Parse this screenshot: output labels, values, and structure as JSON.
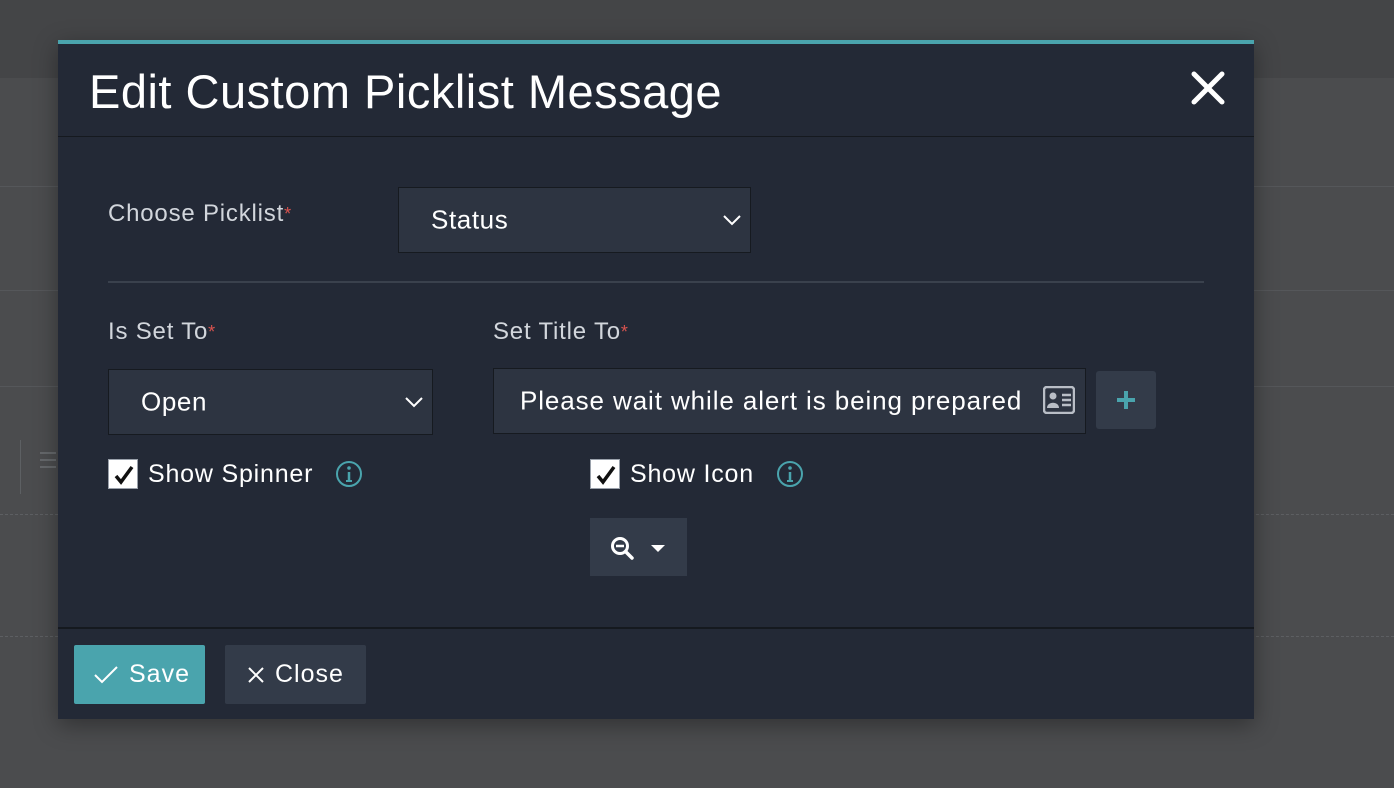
{
  "modal": {
    "title": "Edit Custom Picklist Message",
    "close_icon": "close-icon"
  },
  "form": {
    "choose_picklist": {
      "label": "Choose Picklist",
      "required_marker": "*",
      "value": "Status"
    },
    "is_set_to": {
      "label": "Is Set To",
      "required_marker": "*",
      "value": "Open"
    },
    "set_title_to": {
      "label": "Set Title To",
      "required_marker": "*",
      "value": "Please wait while alert is being prepared"
    },
    "show_spinner": {
      "label": "Show Spinner",
      "checked": true
    },
    "show_icon": {
      "label": "Show Icon",
      "checked": true,
      "selected_icon": "search-minus-icon"
    }
  },
  "footer": {
    "save_label": "Save",
    "close_label": "Close"
  },
  "colors": {
    "accent": "#4aa4ad",
    "modal_bg": "#232936",
    "field_bg": "#2d3441",
    "required": "#d9534f"
  }
}
